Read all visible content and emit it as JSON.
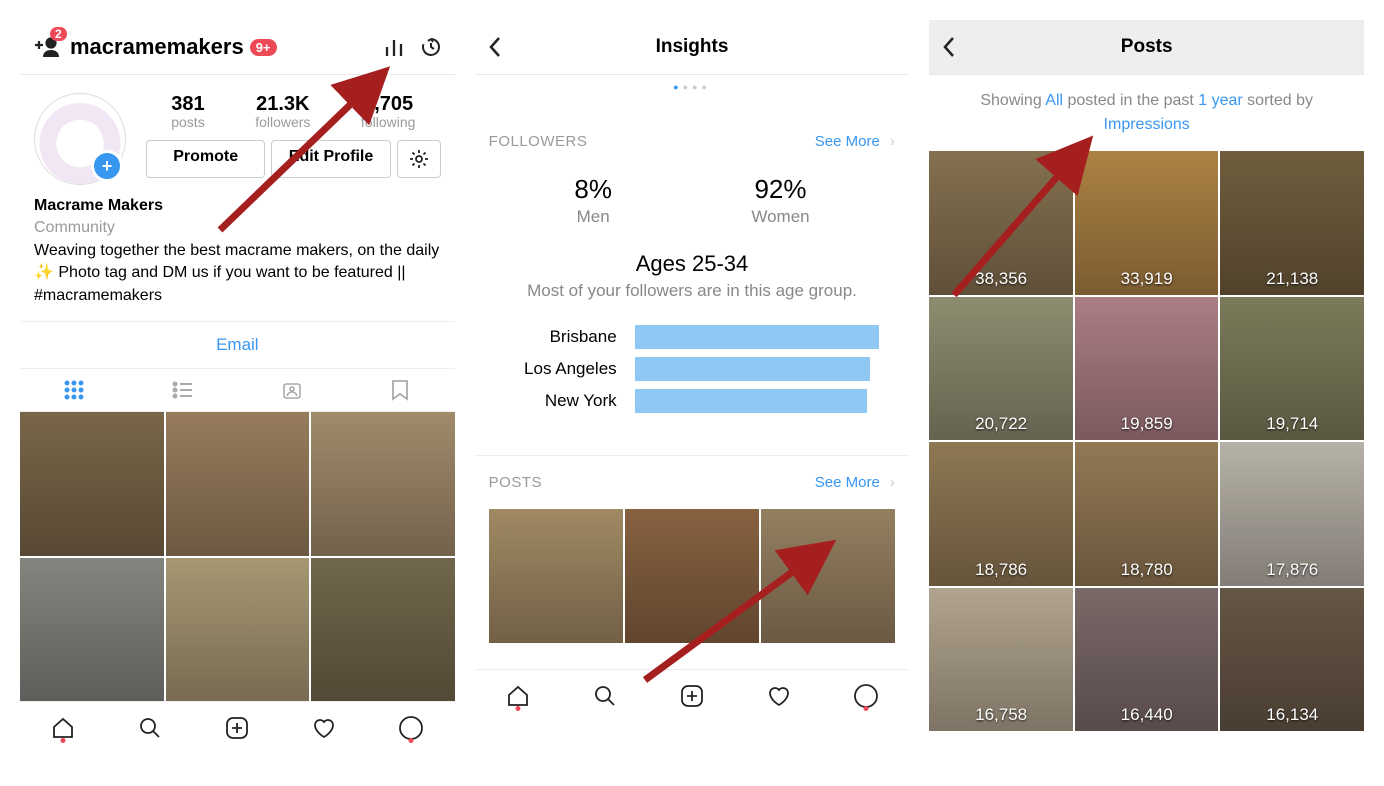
{
  "profile": {
    "username": "macramemakers",
    "notif_badge": "9+",
    "add_badge": "2",
    "stats": {
      "posts": "381",
      "posts_l": "posts",
      "followers": "21.3K",
      "followers_l": "followers",
      "following": "4,705",
      "following_l": "following"
    },
    "promote": "Promote",
    "edit": "Edit Profile",
    "name": "Macrame Makers",
    "category": "Community",
    "bio": "Weaving together the best macrame makers, on the daily ✨ Photo tag and DM us if you want to be featured || #macramemakers",
    "email": "Email"
  },
  "insights": {
    "title": "Insights",
    "followers_h": "FOLLOWERS",
    "seemore": "See More",
    "men_pct": "8%",
    "men_l": "Men",
    "women_pct": "92%",
    "women_l": "Women",
    "ages_h": "Ages 25-34",
    "ages_s": "Most of your followers are in this age group.",
    "locations": [
      {
        "name": "Brisbane",
        "w": 1
      },
      {
        "name": "Los Angeles",
        "w": 0.96
      },
      {
        "name": "New York",
        "w": 0.95
      }
    ],
    "posts_h": "POSTS"
  },
  "posts": {
    "title": "Posts",
    "f1": "Showing ",
    "f2": "All",
    "f3": " posted in the past ",
    "f4": "1 year",
    "f5": " sorted by ",
    "f6": "Impressions",
    "values": [
      "38,356",
      "33,919",
      "21,138",
      "20,722",
      "19,859",
      "19,714",
      "18,786",
      "18,780",
      "17,876",
      "16,758",
      "16,440",
      "16,134"
    ]
  }
}
